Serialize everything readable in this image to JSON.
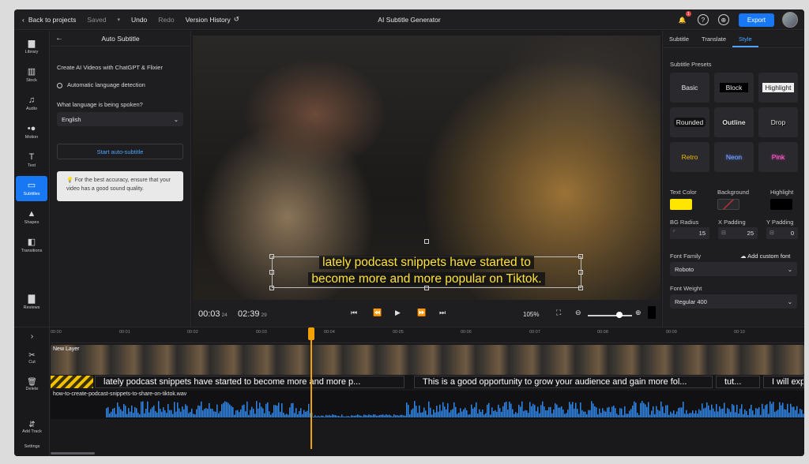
{
  "topbar": {
    "back": "Back to projects",
    "saved": "Saved",
    "undo": "Undo",
    "redo": "Redo",
    "version_history": "Version History",
    "title": "AI Subtitle Generator",
    "export": "Export",
    "notification_count": "1"
  },
  "rail": [
    "Library",
    "Stock",
    "Audio",
    "Motion",
    "Text",
    "Subtitles",
    "Shapes",
    "Transitions",
    "Reviews"
  ],
  "panel": {
    "title": "Auto Subtitle",
    "promo": "Create AI Videos with ChatGPT & Flixier",
    "auto_detect": "Automatic language detection",
    "question": "What language is being spoken?",
    "language": "English",
    "start": "Start auto-subtitle",
    "tip": "For the best accuracy, ensure that your video has a good sound quality."
  },
  "preview": {
    "caption_line1": "lately podcast snippets have started to",
    "caption_line2": "become more and more popular on Tiktok."
  },
  "player": {
    "current_time": "00:03",
    "current_frame": "24",
    "total_time": "02:39",
    "total_frame": "29",
    "zoom": "105%"
  },
  "rpanel": {
    "tabs": [
      "Subtitle",
      "Translate",
      "Style"
    ],
    "presets_label": "Subtitle Presets",
    "presets": [
      "Basic",
      "Block",
      "Highlight",
      "Rounded",
      "Outline",
      "Drop",
      "Retro",
      "Neon",
      "Pink"
    ],
    "text_color": "Text Color",
    "background": "Background",
    "highlight": "Highlight",
    "bg_radius": "BG Radius",
    "bg_radius_val": "15",
    "x_padding": "X Padding",
    "x_padding_val": "25",
    "y_padding": "Y Padding",
    "y_padding_val": "0",
    "font_family": "Font Family",
    "add_font": "Add custom font",
    "font": "Roboto",
    "font_weight": "Font Weight",
    "weight": "Regular 400",
    "colors": {
      "text": "#ffe600",
      "highlight": "#000000",
      "accent": "#1877f2"
    }
  },
  "timeline": {
    "tools": [
      "Cut",
      "Delete",
      "Add Track",
      "Settings"
    ],
    "ticks": [
      "00:00",
      "00:01",
      "00:02",
      "00:03",
      "00:04",
      "00:05",
      "00:06",
      "00:07",
      "00:08",
      "00:09",
      "00:10"
    ],
    "layer": "New Layer",
    "subtitles": [
      "lately podcast snippets have started to become more and more p...",
      "This is a good opportunity to grow your audience and gain more fol...",
      "tut...",
      "I will expla"
    ],
    "audio_file": "how-to-create-podcast-snippets-to-share-on-tiktok.wav"
  }
}
